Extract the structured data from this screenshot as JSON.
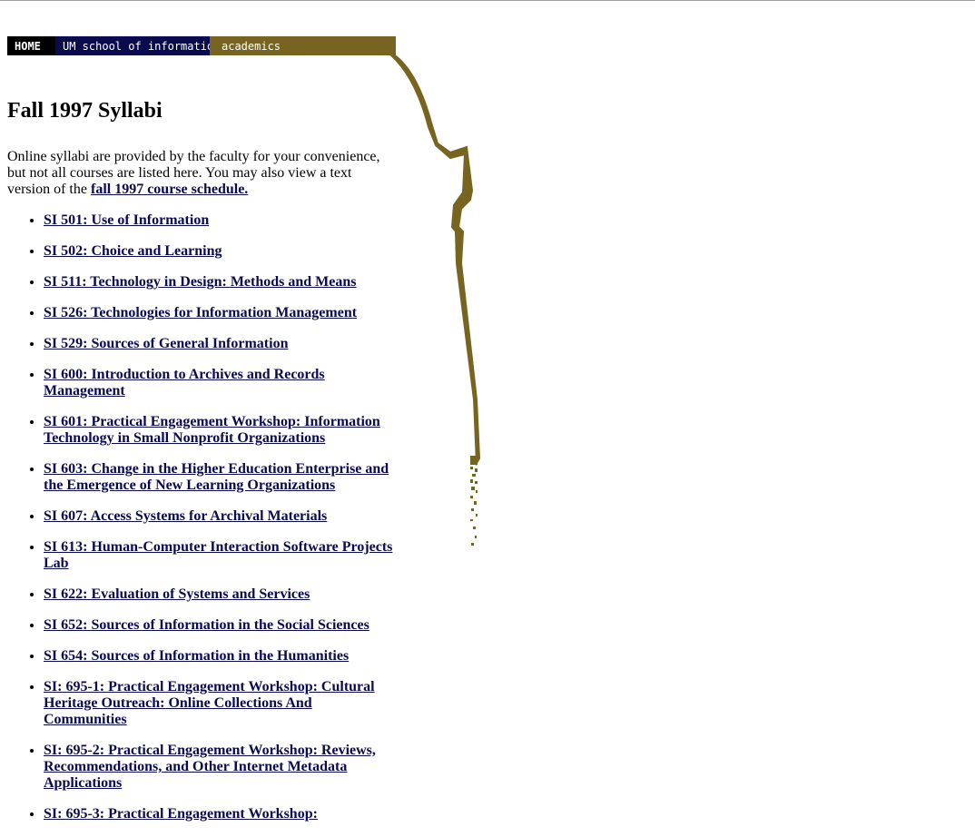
{
  "nav": {
    "home": "HOME",
    "school": "UM school of information",
    "academics": "academics"
  },
  "colors": {
    "nav_home_bg": "#000000",
    "nav_school_bg": "#0a0a50",
    "nav_academics_bg": "#766420",
    "link": "#0a0a50"
  },
  "page": {
    "title": "Fall 1997 Syllabi",
    "intro_text": "Online syllabi are provided by the faculty for your convenience, but not all courses are listed here. You may also view a text version of the ",
    "schedule_link": "fall 1997 course schedule."
  },
  "courses": [
    "SI 501: Use of Information",
    "SI 502: Choice and Learning",
    "SI 511: Technology in Design: Methods and Means",
    "SI 526: Technologies for Information Management",
    "SI 529: Sources of General Information",
    "SI 600: Introduction to Archives and Records Management",
    "SI 601: Practical Engagement Workshop: Information Technology in Small Nonprofit Organizations",
    "SI 603: Change in the Higher Education Enterprise and the Emergence of New Learning Organizations",
    "SI 607: Access Systems for Archival Materials",
    "SI 613: Human-Computer Interaction Software Projects Lab",
    "SI 622: Evaluation of Systems and Services",
    "SI 652: Sources of Information in the Social Sciences",
    "SI 654: Sources of Information in the Humanities",
    "SI: 695-1: Practical Engagement Workshop: Cultural Heritage Outreach: Online Collections And Communities",
    "SI: 695-2: Practical Engagement Workshop: Reviews, Recommendations, and Other Internet Metadata Applications",
    "SI: 695-3: Practical Engagement Workshop:"
  ]
}
